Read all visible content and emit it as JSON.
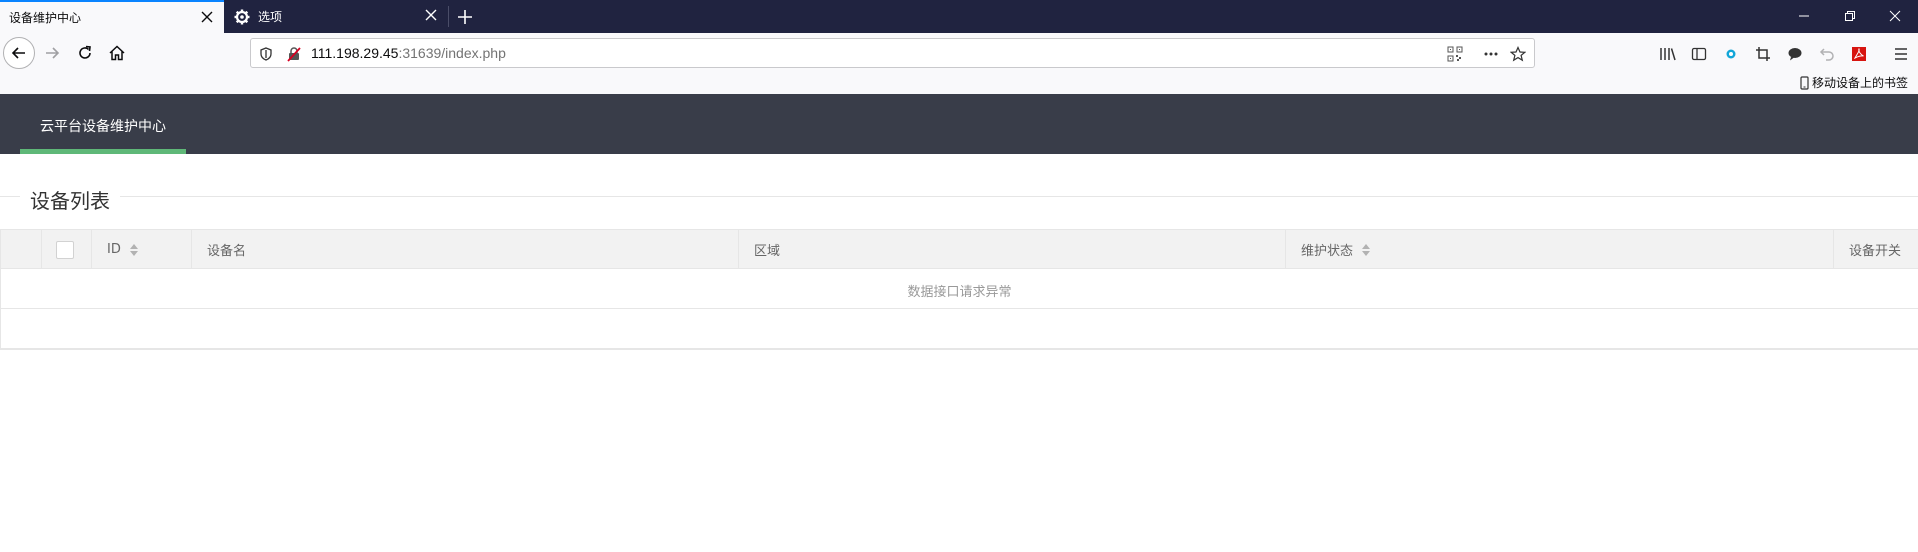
{
  "browser": {
    "tabs": [
      {
        "title": "设备维护中心",
        "active": true
      },
      {
        "title": "选项",
        "active": false
      }
    ],
    "url": {
      "host": "111.198.29.45",
      "rest": ":31639/index.php"
    },
    "bookmarks": {
      "mobile_label": "移动设备上的书签"
    }
  },
  "app": {
    "nav": {
      "active_tab": "云平台设备维护中心"
    },
    "section_title": "设备列表",
    "table": {
      "columns": [
        "ID",
        "设备名",
        "区域",
        "维护状态",
        "设备开关"
      ],
      "empty_message": "数据接口请求异常"
    }
  },
  "colors": {
    "header_bg": "#393d49",
    "active_underline": "#5fb878",
    "tab_strip_bg": "#202340"
  }
}
